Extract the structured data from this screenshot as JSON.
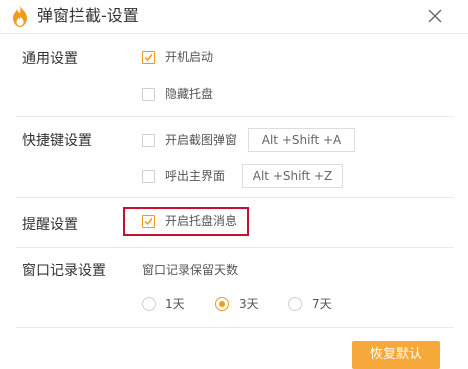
{
  "window": {
    "title": "弹窗拦截-设置",
    "close_icon": "close-icon",
    "app_icon": "flame-icon"
  },
  "colors": {
    "accent": "#f39a1c",
    "button": "#f7a83a",
    "highlight": "#c8102e",
    "text": "#333333"
  },
  "sections": {
    "general": {
      "label": "通用设置",
      "options": [
        {
          "label": "开机启动",
          "checked": true
        },
        {
          "label": "隐藏托盘",
          "checked": false
        }
      ]
    },
    "hotkeys": {
      "label": "快捷键设置",
      "options": [
        {
          "label": "开启截图弹窗",
          "checked": false,
          "hotkey": "Alt +Shift +A"
        },
        {
          "label": "呼出主界面",
          "checked": false,
          "hotkey": "Alt +Shift +Z"
        }
      ]
    },
    "reminder": {
      "label": "提醒设置",
      "options": [
        {
          "label": "开启托盘消息",
          "checked": true
        }
      ]
    },
    "records": {
      "label": "窗口记录设置",
      "subtitle": "窗口记录保留天数",
      "retention_options": [
        "1天",
        "3天",
        "7天"
      ],
      "selected": "3天"
    }
  },
  "footer": {
    "reset_label": "恢复默认"
  }
}
